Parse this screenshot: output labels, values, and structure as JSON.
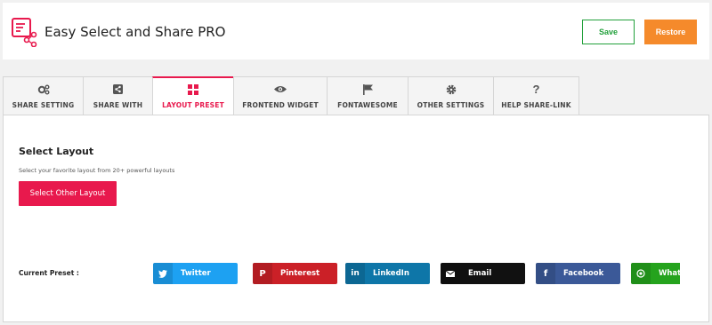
{
  "header": {
    "title": "Easy Select and Share PRO",
    "save_label": "Save",
    "restore_label": "Restore"
  },
  "tabs": [
    {
      "label": "SHARE SETTING",
      "icon": "gears-icon",
      "active": false
    },
    {
      "label": "SHARE WITH",
      "icon": "share-icon",
      "active": false
    },
    {
      "label": "LAYOUT PRESET",
      "icon": "grid-icon",
      "active": true
    },
    {
      "label": "FRONTEND WIDGET",
      "icon": "eye-icon",
      "active": false
    },
    {
      "label": "FONTAWESOME",
      "icon": "flag-icon",
      "active": false
    },
    {
      "label": "OTHER SETTINGS",
      "icon": "gear-icon",
      "active": false
    },
    {
      "label": "HELP SHARE-LINK",
      "icon": "question-icon",
      "active": false
    }
  ],
  "panel": {
    "title": "Select Layout",
    "subtitle": "Select your favorite layout from 20+ powerful layouts",
    "button_label": "Select Other Layout",
    "preset_label": "Current Preset :"
  },
  "share_buttons": [
    {
      "label": "Twitter",
      "icon": "twitter-icon",
      "color": "#1da1f2"
    },
    {
      "label": "Pinterest",
      "icon": "pinterest-icon",
      "color": "#cb2027"
    },
    {
      "label": "LinkedIn",
      "icon": "linkedin-icon",
      "color": "#0e76a8"
    },
    {
      "label": "Email",
      "icon": "envelope-icon",
      "color": "#111111"
    },
    {
      "label": "Facebook",
      "icon": "facebook-icon",
      "color": "#3b5998"
    },
    {
      "label": "WhatsApp",
      "icon": "whatsapp-icon",
      "color": "#25a31d"
    }
  ],
  "colors": {
    "accent": "#e8194d",
    "save": "#22a03b",
    "restore": "#f58a2b"
  }
}
